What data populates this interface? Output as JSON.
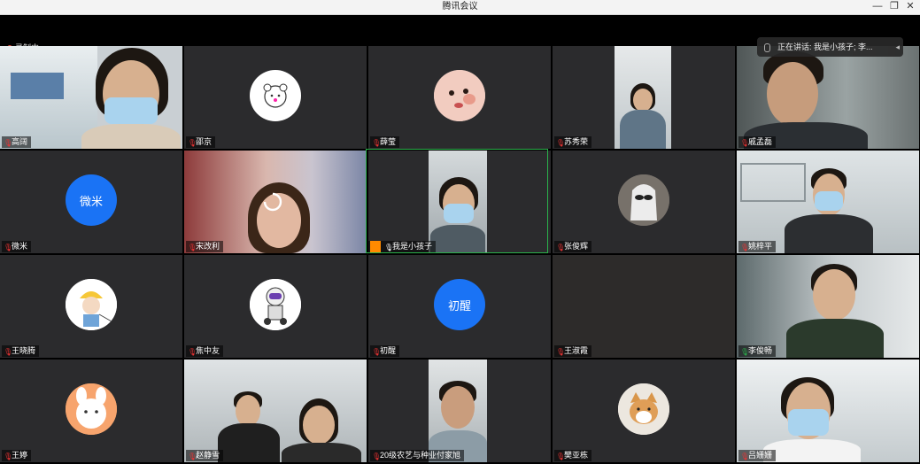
{
  "window": {
    "title": "腾讯会议"
  },
  "recording": {
    "label": "录制中"
  },
  "speaking": {
    "text": "正在讲话: 我是小孩子; 李..."
  },
  "participants": [
    {
      "name": "高阔"
    },
    {
      "name": "邵京"
    },
    {
      "name": "薛莹"
    },
    {
      "name": "苏秀荣"
    },
    {
      "name": "戚孟磊"
    },
    {
      "name": "微米",
      "avatar_text": "微米"
    },
    {
      "name": "宋改利"
    },
    {
      "name": "我是小孩子"
    },
    {
      "name": "张俊辉"
    },
    {
      "name": "姚梓平"
    },
    {
      "name": "王晓腾"
    },
    {
      "name": "焦中友"
    },
    {
      "name": "初醒",
      "avatar_text": "初醒"
    },
    {
      "name": "王淑霞"
    },
    {
      "name": "李俊畅"
    },
    {
      "name": "王婷"
    },
    {
      "name": "赵静雪"
    },
    {
      "name": "20级农艺与种业付家旭"
    },
    {
      "name": "樊亚栋"
    },
    {
      "name": "吕姗姗"
    }
  ],
  "colors": {
    "tile_bg": "#2b2b2d",
    "avatar_blue": "#1a73f5",
    "active_speaker": "#2ab04a",
    "mic_muted": "#e33"
  }
}
